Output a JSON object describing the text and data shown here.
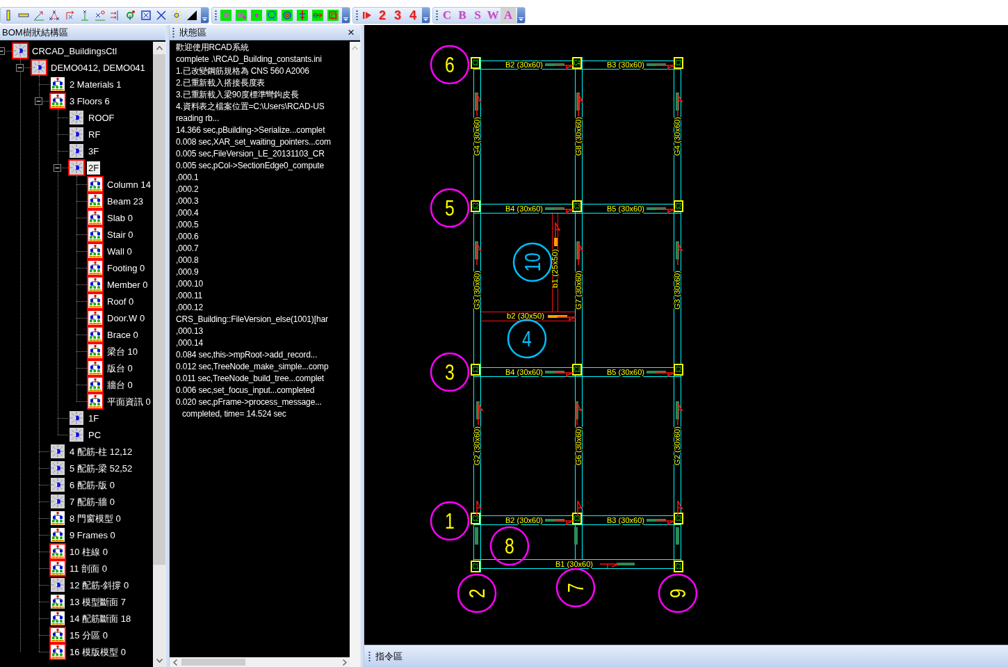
{
  "toolbar": {
    "number_buttons": [
      "2",
      "3",
      "4"
    ],
    "letter_buttons": [
      {
        "label": "C",
        "selected": false
      },
      {
        "label": "B",
        "selected": false
      },
      {
        "label": "S",
        "selected": false
      },
      {
        "label": "W",
        "selected": false
      },
      {
        "label": "A",
        "selected": true
      }
    ]
  },
  "tree_panel": {
    "title": "BOM樹狀結構區",
    "items": [
      {
        "label": "CRCAD_BuildingsCtl",
        "kind": "sun",
        "marked": true,
        "selected": false,
        "expanded": true,
        "children": [
          {
            "label": "DEMO0412, DEMO041",
            "kind": "sun",
            "marked": true,
            "selected": false,
            "expanded": true,
            "children": [
              {
                "label": "2 Materials 1",
                "kind": "hierarchy",
                "marked": false,
                "selected": false
              },
              {
                "label": "3 Floors 6",
                "kind": "hierarchy",
                "marked": true,
                "selected": false,
                "expanded": true,
                "children": [
                  {
                    "label": "ROOF",
                    "kind": "sun",
                    "marked": false,
                    "selected": false
                  },
                  {
                    "label": "RF",
                    "kind": "sun",
                    "marked": false,
                    "selected": false
                  },
                  {
                    "label": "3F",
                    "kind": "sun",
                    "marked": false,
                    "selected": false
                  },
                  {
                    "label": "2F",
                    "kind": "sun",
                    "marked": true,
                    "selected": true,
                    "expanded": true,
                    "children": [
                      {
                        "label": "Column 14",
                        "kind": "hierarchy",
                        "marked": true,
                        "selected": false
                      },
                      {
                        "label": "Beam 23",
                        "kind": "hierarchy",
                        "marked": true,
                        "selected": false
                      },
                      {
                        "label": "Slab 0",
                        "kind": "hierarchy",
                        "marked": true,
                        "selected": false
                      },
                      {
                        "label": "Stair 0",
                        "kind": "hierarchy",
                        "marked": true,
                        "selected": false
                      },
                      {
                        "label": "Wall 0",
                        "kind": "hierarchy",
                        "marked": true,
                        "selected": false
                      },
                      {
                        "label": "Footing 0",
                        "kind": "hierarchy",
                        "marked": true,
                        "selected": false
                      },
                      {
                        "label": "Member 0",
                        "kind": "hierarchy",
                        "marked": true,
                        "selected": false
                      },
                      {
                        "label": "Roof 0",
                        "kind": "hierarchy",
                        "marked": true,
                        "selected": false
                      },
                      {
                        "label": "Door.W 0",
                        "kind": "hierarchy",
                        "marked": true,
                        "selected": false
                      },
                      {
                        "label": "Brace 0",
                        "kind": "hierarchy",
                        "marked": true,
                        "selected": false
                      },
                      {
                        "label": "梁台 10",
                        "kind": "hierarchy",
                        "marked": true,
                        "selected": false
                      },
                      {
                        "label": "版台 0",
                        "kind": "hierarchy",
                        "marked": true,
                        "selected": false
                      },
                      {
                        "label": "牆台 0",
                        "kind": "hierarchy",
                        "marked": true,
                        "selected": false
                      },
                      {
                        "label": "平面資訊 0",
                        "kind": "hierarchy",
                        "marked": true,
                        "selected": false
                      }
                    ]
                  },
                  {
                    "label": "1F",
                    "kind": "sun",
                    "marked": false,
                    "selected": false
                  },
                  {
                    "label": "PC",
                    "kind": "sun",
                    "marked": false,
                    "selected": false
                  }
                ]
              },
              {
                "label": "4 配筋-柱 12,12",
                "kind": "sun",
                "marked": false,
                "selected": false
              },
              {
                "label": "5 配筋-梁 52,52",
                "kind": "sun",
                "marked": false,
                "selected": false
              },
              {
                "label": "6 配筋-版 0",
                "kind": "sun",
                "marked": false,
                "selected": false
              },
              {
                "label": "7 配筋-牆 0",
                "kind": "sun",
                "marked": false,
                "selected": false
              },
              {
                "label": "8 門窗模型 0",
                "kind": "hierarchy",
                "marked": false,
                "selected": false
              },
              {
                "label": "9 Frames 0",
                "kind": "hierarchy",
                "marked": false,
                "selected": false
              },
              {
                "label": "10 柱線 0",
                "kind": "hierarchy",
                "marked": true,
                "selected": false
              },
              {
                "label": "11 剖面 0",
                "kind": "hierarchy",
                "marked": true,
                "selected": false
              },
              {
                "label": "12 配筋-斜撐 0",
                "kind": "sun",
                "marked": false,
                "selected": false
              },
              {
                "label": "13 模型斷面 7",
                "kind": "hierarchy",
                "marked": false,
                "selected": false
              },
              {
                "label": "14 配筋斷面 18",
                "kind": "hierarchy",
                "marked": false,
                "selected": false
              },
              {
                "label": "15 分區 0",
                "kind": "hierarchy",
                "marked": true,
                "selected": false
              },
              {
                "label": "16 模版模型 0",
                "kind": "hierarchy",
                "marked": true,
                "selected": false
              }
            ]
          }
        ]
      }
    ]
  },
  "status_panel": {
    "title": "狀態區",
    "close": "×",
    "lines": [
      "歡迎使用RCAD系統",
      "complete .\\RCAD_Building_constants.ini",
      "1.已改變鋼筋規格為 CNS 560 A2006",
      "2.已重新載入搭接長度表",
      "3.已重新載入梁90度標準彎鉤皮長",
      "4.資料表之檔案位置=C:\\Users\\RCAD-US",
      "reading rb...",
      "14.366 sec,pBuilding->Serialize...complet",
      "0.008 sec,XAR_set_waiting_pointers...com",
      "0.005 sec,FileVersion_LE_20131103_CR",
      "0.005 sec,pCol->SectionEdge0_compute",
      ",000.1",
      ",000.2",
      ",000.3",
      ",000.4",
      ",000.5",
      ",000.6",
      ",000.7",
      ",000.8",
      ",000.9",
      ",000.10",
      ",000.11",
      ",000.12",
      "CRS_Building::FileVersion_else(1001)[har",
      ",000.13",
      ",000.14",
      "0.084 sec,this->mpRoot->add_record...",
      "0.012 sec,TreeNode_make_simple...comp",
      "0.011 sec,TreeNode_build_tree...complet",
      "0.006 sec,set_focus_input...completed",
      "0.020 sec,pFrame->process_message..."
    ],
    "summary": "completed, time= 14.524 sec"
  },
  "plan": {
    "grid_bubbles": [
      {
        "label": "6",
        "kind": "axis",
        "color": "#ff00ff"
      },
      {
        "label": "5",
        "kind": "axis",
        "color": "#ff00ff"
      },
      {
        "label": "10",
        "kind": "callout",
        "color": "#00bfff"
      },
      {
        "label": "4",
        "kind": "callout",
        "color": "#00bfff"
      },
      {
        "label": "3",
        "kind": "axis",
        "color": "#ff00ff"
      },
      {
        "label": "1",
        "kind": "axis",
        "color": "#ff00ff"
      },
      {
        "label": "8",
        "kind": "axis",
        "color": "#ff00ff"
      },
      {
        "label": "2",
        "kind": "axis",
        "color": "#ff00ff"
      },
      {
        "label": "7",
        "kind": "axis",
        "color": "#ff00ff"
      },
      {
        "label": "9",
        "kind": "axis",
        "color": "#ff00ff"
      }
    ],
    "columns": [
      {
        "label": "C2"
      },
      {
        "label": "C4"
      },
      {
        "label": "C2"
      },
      {
        "label": "C2"
      },
      {
        "label": "C3"
      },
      {
        "label": "C2"
      },
      {
        "label": "C2"
      },
      {
        "label": "C3"
      },
      {
        "label": "C2"
      },
      {
        "label": "C2"
      },
      {
        "label": "C3"
      },
      {
        "label": "C2"
      },
      {
        "label": "C1"
      },
      {
        "label": "C1"
      }
    ],
    "beam_labels": [
      {
        "text": "B2 (30x60)",
        "kind": "main"
      },
      {
        "text": "B3 (30x60)",
        "kind": "main"
      },
      {
        "text": "G4 (30x60)",
        "kind": "main"
      },
      {
        "text": "G8 (30x60)",
        "kind": "main"
      },
      {
        "text": "G4 (30x60)",
        "kind": "main"
      },
      {
        "text": "B4 (30x60)",
        "kind": "main"
      },
      {
        "text": "B5 (30x60)",
        "kind": "main"
      },
      {
        "text": "b1 (25x50)",
        "kind": "secondary"
      },
      {
        "text": "G3 (30x60)",
        "kind": "main"
      },
      {
        "text": "G7 (30x60)",
        "kind": "main"
      },
      {
        "text": "G3 (30x60)",
        "kind": "main"
      },
      {
        "text": "b2 (30x50)",
        "kind": "secondary"
      },
      {
        "text": "B4 (30x60)",
        "kind": "main"
      },
      {
        "text": "B5 (30x60)",
        "kind": "main"
      },
      {
        "text": "G2 (30x60)",
        "kind": "main"
      },
      {
        "text": "G6 (30x60)",
        "kind": "main"
      },
      {
        "text": "G2 (30x60)",
        "kind": "main"
      },
      {
        "text": "B2 (30x60)",
        "kind": "main"
      },
      {
        "text": "B3 (30x60)",
        "kind": "main"
      },
      {
        "text": "B1 (30x60)",
        "kind": "main"
      }
    ]
  },
  "command_bar": {
    "title": "指令區"
  }
}
